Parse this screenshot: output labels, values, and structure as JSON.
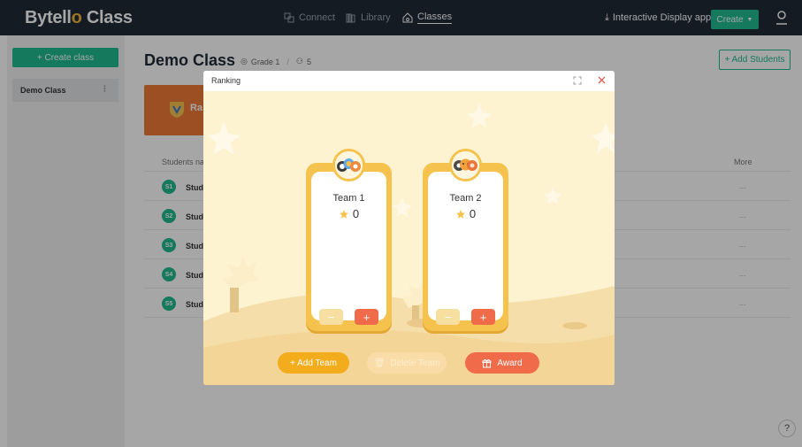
{
  "app": {
    "logo_main": "Bytell",
    "logo_accent": "o",
    "logo_suffix": " Class"
  },
  "nav": {
    "connect": "Connect",
    "library": "Library",
    "classes": "Classes",
    "interactive_display": "Interactive Display app",
    "create": "Create"
  },
  "sidebar": {
    "create_class": "+ Create class",
    "items": [
      {
        "label": "Demo Class"
      }
    ]
  },
  "main": {
    "title": "Demo Class",
    "grade": "Grade 1",
    "student_count": "5",
    "add_students": "+ Add Students",
    "ranking_card_label": "Ra",
    "students_header": "Students nam",
    "more_header": "More",
    "students": [
      {
        "badge": "S1",
        "name": "Stude",
        "more": "..."
      },
      {
        "badge": "S2",
        "name": "Stude",
        "more": "..."
      },
      {
        "badge": "S3",
        "name": "Stude",
        "more": "..."
      },
      {
        "badge": "S4",
        "name": "Stude",
        "more": "..."
      },
      {
        "badge": "S5",
        "name": "Stude",
        "more": "..."
      }
    ]
  },
  "modal": {
    "title": "Ranking",
    "teams": [
      {
        "name": "Team 1",
        "score": "0",
        "minus": "−",
        "plus": "+"
      },
      {
        "name": "Team 2",
        "score": "0",
        "minus": "−",
        "plus": "+"
      }
    ],
    "add_team": "+ Add Team",
    "delete_team": "Delete Team",
    "award": "Award"
  },
  "help": "?",
  "colors": {
    "topbar": "#1f2a36",
    "brand_green": "#1fba8f",
    "modal_bg": "#fdf3d1",
    "card_yellow": "#f6c24e",
    "accent_orange": "#ef6b4a",
    "add_team_yellow": "#f2ac1c"
  }
}
